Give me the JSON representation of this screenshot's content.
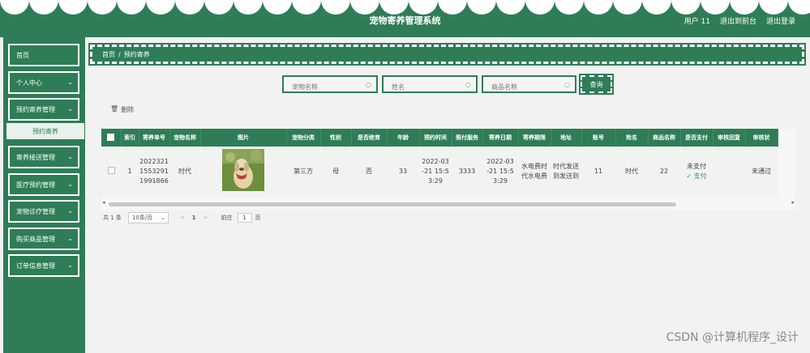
{
  "header": {
    "title": "宠物寄养管理系统",
    "user": "用户 11",
    "back_to_front": "退出到前台",
    "logout": "退出登录"
  },
  "sidebar": {
    "items": [
      {
        "label": "首页",
        "has_chevron": false
      },
      {
        "label": "个人中心",
        "has_chevron": true
      },
      {
        "label": "预约寄养管理",
        "has_chevron": true
      },
      {
        "label": "寄养接送管理",
        "has_chevron": true
      },
      {
        "label": "医疗预约管理",
        "has_chevron": true
      },
      {
        "label": "宠物诊疗管理",
        "has_chevron": true
      },
      {
        "label": "购买商品管理",
        "has_chevron": true
      },
      {
        "label": "订单信息管理",
        "has_chevron": true
      }
    ],
    "active_sub": "预约寄养"
  },
  "breadcrumb": {
    "home": "首页",
    "sep": "/",
    "current": "预约寄养"
  },
  "search": {
    "pet_name_placeholder": "宠物名称",
    "name_placeholder": "姓名",
    "product_placeholder": "商品名称",
    "query_label": "查询"
  },
  "actions": {
    "delete_label": "删除"
  },
  "table": {
    "columns": [
      "索引",
      "寄养单号",
      "宠物名称",
      "图片",
      "宠物分类",
      "性别",
      "是否绝育",
      "年龄",
      "预约时间",
      "照付服务",
      "寄养日期",
      "寄养期限",
      "地址",
      "账号",
      "姓名",
      "商品名称",
      "是否支付",
      "审核回复",
      "审核状"
    ],
    "rows": [
      {
        "index": "1",
        "order_no": "2022321 1553291 1991866",
        "pet_name": "时代",
        "category": "第三方",
        "gender": "母",
        "neutered": "否",
        "age": "33",
        "reserve_time": "2022-03 -21 15:5 3:29",
        "service": "3333",
        "foster_date": "2022-03 -21 15:5 3:29",
        "foster_term": "水电费时 代水电费",
        "address": "时代发送 到发送到",
        "account": "11",
        "name": "时代",
        "product_name": "22",
        "paid": "未支付",
        "pay_action": "支付",
        "review_reply": "",
        "review_status": "未通过"
      }
    ]
  },
  "pagination": {
    "total": "共 1 条",
    "page_size": "10条/页",
    "prev": "<",
    "current": "1",
    "next": ">",
    "goto": "前往",
    "page_input": "1",
    "page_unit": "页"
  },
  "watermark": "CSDN @计算机程序_设计",
  "colors": {
    "primary": "#2e7d57",
    "background": "#f2f2f2"
  }
}
